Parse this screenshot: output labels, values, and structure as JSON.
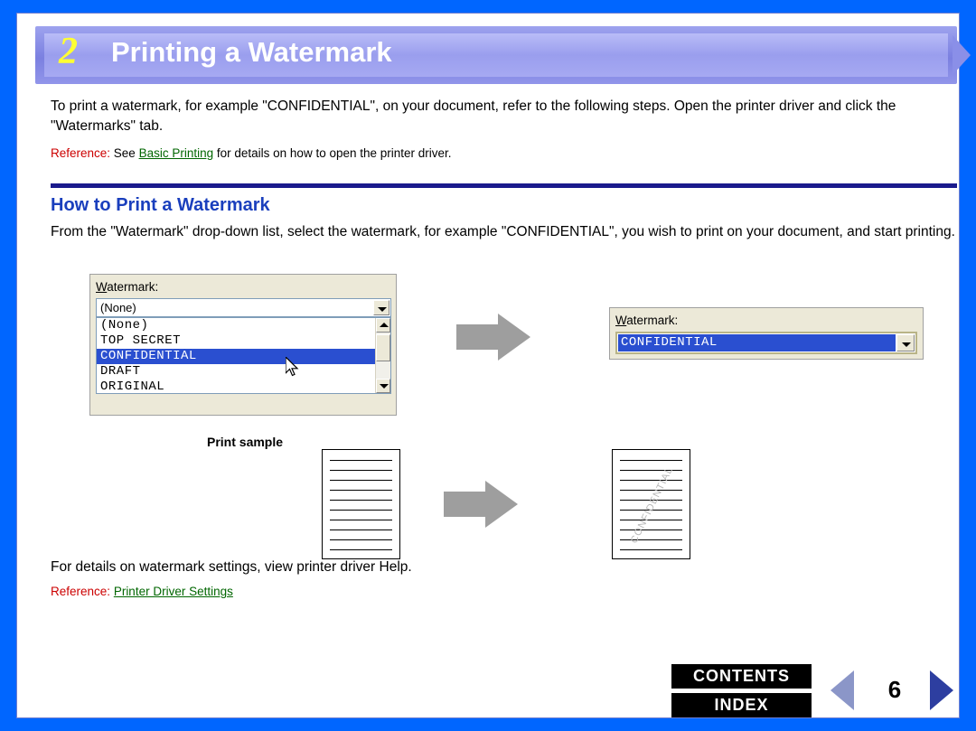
{
  "header": {
    "chapter_number": "2",
    "title": "Printing a Watermark"
  },
  "intro": {
    "paragraph": "To print a watermark, for example \"CONFIDENTIAL\", on your document, refer to the following steps. Open the printer driver and click the \"Watermarks\" tab.",
    "reference_label": "Reference:",
    "reference_prefix": " See ",
    "reference_link": "Basic Printing",
    "reference_suffix": " for details on how to open the printer driver."
  },
  "section": {
    "title": "How to Print a Watermark",
    "body": "From the \"Watermark\" drop-down list, select the watermark, for example \"CONFIDENTIAL\", you wish to print on your document, and start printing."
  },
  "dialog_left": {
    "label": "Watermark:",
    "label_underlined_char": "W",
    "selected_value": "(None)",
    "options": [
      "(None)",
      "TOP SECRET",
      "CONFIDENTIAL",
      "DRAFT",
      "ORIGINAL"
    ],
    "highlighted_option": "CONFIDENTIAL"
  },
  "dialog_right": {
    "label": "Watermark:",
    "label_underlined_char": "W",
    "selected_value": "CONFIDENTIAL"
  },
  "print_sample": {
    "label": "Print sample",
    "watermark_text": "CONFIDENTIAL"
  },
  "footer": {
    "text": "For details on watermark settings, view printer driver Help.",
    "reference_label": "Reference:",
    "reference_link": "Printer Driver Settings"
  },
  "nav": {
    "contents_label": "CONTENTS",
    "index_label": "INDEX",
    "page_number": "6"
  },
  "colors": {
    "page_border": "#0066ff",
    "banner": "#8a8fe8",
    "chapter_number": "#ffff33",
    "section_title": "#1a3fbd",
    "rule": "#1a1a8c",
    "reference_label": "#cc0000",
    "link": "#006600",
    "selection": "#2a4fd0",
    "arrow_gray": "#9e9e9e"
  }
}
